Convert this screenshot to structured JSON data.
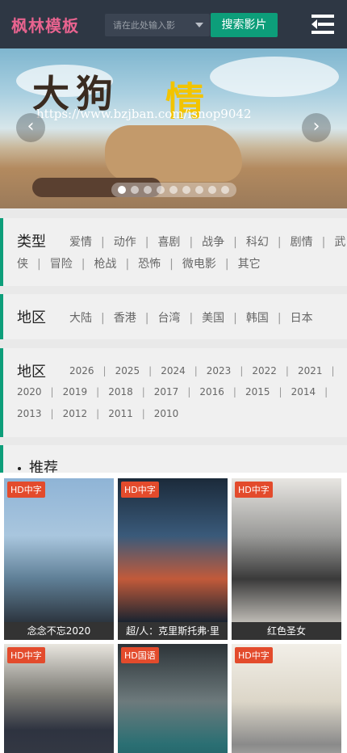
{
  "header": {
    "logo": "枫林模板",
    "search_placeholder": "请在此处输入影",
    "search_button": "搜索影片"
  },
  "banner": {
    "watermark": "https://www.bzjban.com/isnop9042",
    "title_part1": "大狗",
    "title_part2": "情"
  },
  "genre": {
    "title": "类型",
    "line1": [
      "爱情",
      "动作",
      "喜剧",
      "战争",
      "科幻",
      "剧情",
      "武"
    ],
    "line2": [
      "侠",
      "冒险",
      "枪战",
      "恐怖",
      "微电影",
      "其它"
    ]
  },
  "region": {
    "title": "地区",
    "items": [
      "大陆",
      "香港",
      "台湾",
      "美国",
      "韩国",
      "日本"
    ]
  },
  "year": {
    "title": "地区",
    "line1": [
      "2026",
      "2025",
      "2024",
      "2023",
      "2022",
      "2021"
    ],
    "line2": [
      "2020",
      "2019",
      "2018",
      "2017",
      "2016",
      "2015",
      "2014"
    ],
    "line3": [
      "2013",
      "2012",
      "2011",
      "2010"
    ]
  },
  "recommend": {
    "title": "推荐",
    "movies": [
      {
        "badge": "HD中字",
        "title": "念念不忘2020",
        "poster_color": "#6a8fb5"
      },
      {
        "badge": "HD中字",
        "title": "超/人：克里斯托弗·里",
        "poster_color": "#1f3d5a"
      },
      {
        "badge": "HD中字",
        "title": "红色圣女",
        "poster_color": "#8a8a8a"
      },
      {
        "badge": "HD中字",
        "title": "",
        "poster_color": "#6e6e6a"
      },
      {
        "badge": "HD国语",
        "title": "",
        "poster_color": "#5d6f7a"
      },
      {
        "badge": "HD中字",
        "title": "",
        "poster_color": "#d9d4cc"
      }
    ]
  },
  "colors": {
    "accent": "#0d9e7a",
    "badge": "#e34b2c",
    "header_bg": "#2e3744",
    "logo": "#e8638f"
  }
}
